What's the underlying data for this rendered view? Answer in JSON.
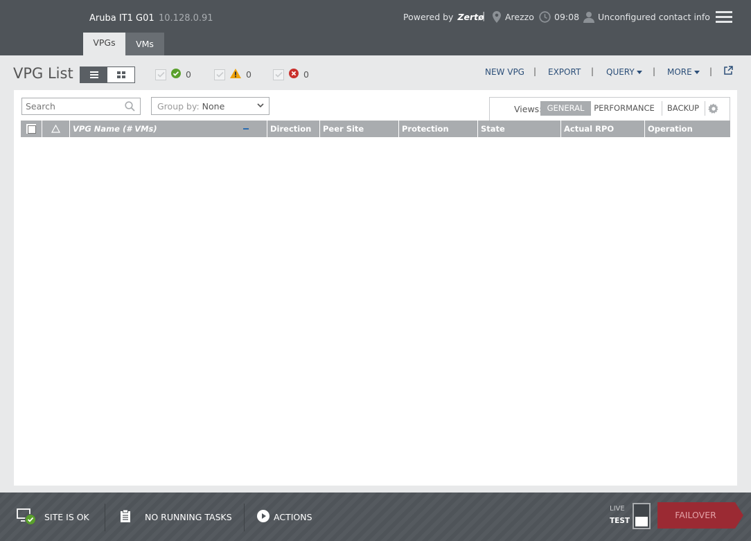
{
  "header": {
    "site_name": "Aruba IT1 G01",
    "site_ip": "10.128.0.91",
    "powered_by": "Powered by",
    "brand": "Zertø",
    "location": "Arezzo",
    "time": "09:08",
    "contact": "Unconfigured contact info",
    "tabs": [
      {
        "label": "VPGs",
        "active": true
      },
      {
        "label": "VMs",
        "active": false
      }
    ]
  },
  "toolbar": {
    "title": "VPG List",
    "filters": [
      {
        "status": "ok",
        "count": "0",
        "color": "#5aa02c"
      },
      {
        "status": "warning",
        "count": "0",
        "color": "#f0a30a"
      },
      {
        "status": "error",
        "count": "0",
        "color": "#c9302c"
      }
    ],
    "actions": {
      "new_vpg": "NEW VPG",
      "export": "EXPORT",
      "query": "QUERY",
      "more": "MORE"
    }
  },
  "panel": {
    "search_placeholder": "Search",
    "group_by_label": "Group by:",
    "group_by_value": "None",
    "views_label": "Views:",
    "views": [
      "GENERAL",
      "PERFORMANCE",
      "BACKUP"
    ],
    "active_view": "GENERAL",
    "columns": [
      "VPG Name (# VMs)",
      "Direction",
      "Peer Site",
      "Protection Status",
      "State",
      "Actual RPO",
      "Operation"
    ],
    "rows": []
  },
  "footer": {
    "site_status": "SITE IS OK",
    "tasks": "NO RUNNING TASKS",
    "actions": "ACTIONS",
    "live": "LIVE",
    "test": "TEST",
    "failover": "FAILOVER"
  },
  "colors": {
    "header_bg": "#4f5459",
    "accent_link": "#2b4e78",
    "failover": "#9b2a33",
    "ok": "#5aa02c"
  }
}
